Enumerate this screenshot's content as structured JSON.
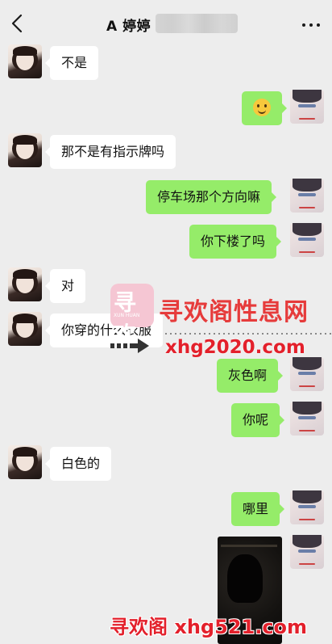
{
  "header": {
    "title": "A 婷婷",
    "back_icon": "chevron-left-icon",
    "more_icon": "more-dots-icon"
  },
  "messages": [
    {
      "side": "in",
      "text": "不是"
    },
    {
      "side": "out",
      "text": "",
      "emoji": "smile-emoji-icon"
    },
    {
      "side": "in",
      "text": "那不是有指示牌吗"
    },
    {
      "side": "out",
      "text": "停车场那个方向嘛"
    },
    {
      "side": "out",
      "text": "你下楼了吗"
    },
    {
      "side": "in",
      "text": "对"
    },
    {
      "side": "in",
      "text": "你穿的什么衣服"
    },
    {
      "side": "out",
      "text": "灰色啊"
    },
    {
      "side": "out",
      "text": "你呢"
    },
    {
      "side": "in",
      "text": "白色的"
    },
    {
      "side": "out",
      "text": "哪里"
    },
    {
      "side": "out",
      "text": "",
      "image": "dark-photo"
    }
  ],
  "watermark": {
    "logo_mark": "寻欢",
    "logo_sub": "XUN HUAN",
    "site_name": "寻欢阁性息网",
    "url_top": "xhg2020.com",
    "bottom": "寻欢阁 xhg521.com"
  },
  "colors": {
    "background": "#ededed",
    "incoming_bubble": "#ffffff",
    "outgoing_bubble": "#95ec69",
    "watermark_red": "#e3202b"
  }
}
